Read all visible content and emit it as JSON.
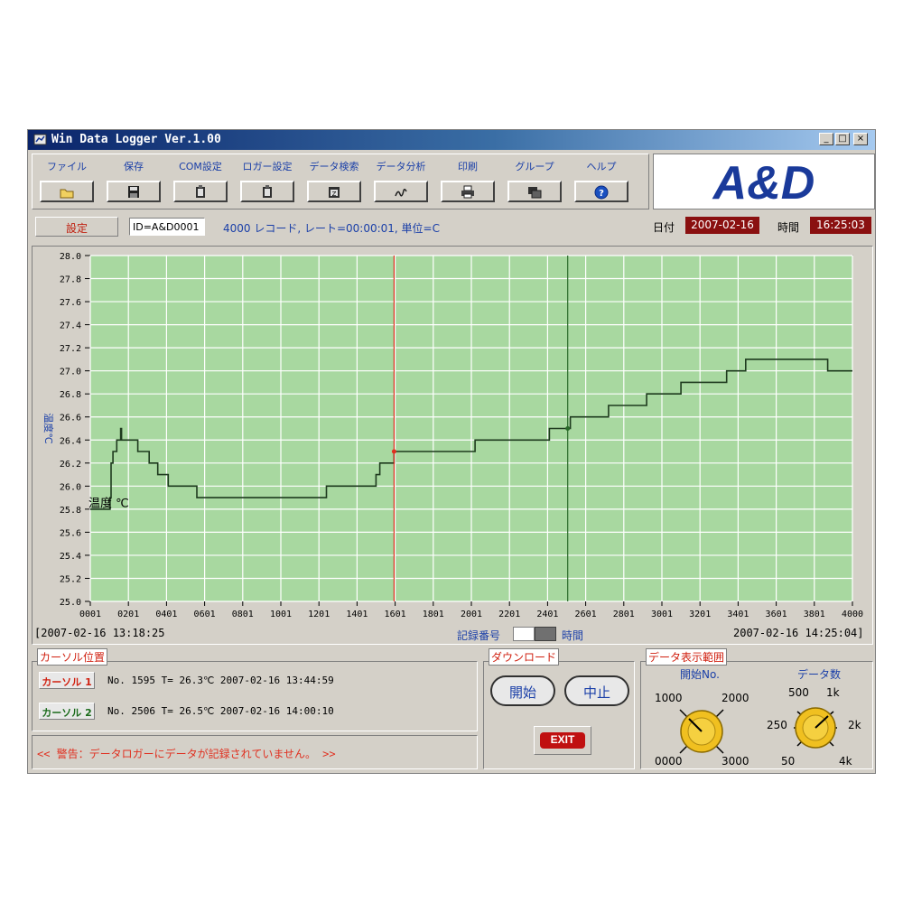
{
  "window": {
    "title": "Win Data Logger Ver.1.00",
    "minimize": "_",
    "maximize": "□",
    "close": "×"
  },
  "toolbar": [
    {
      "label": "ファイル",
      "icon": "open-folder-icon"
    },
    {
      "label": "保存",
      "icon": "floppy-disk-icon"
    },
    {
      "label": "COM設定",
      "icon": "clipboard-icon"
    },
    {
      "label": "ロガー設定",
      "icon": "clipboard-icon"
    },
    {
      "label": "データ検索",
      "icon": "search-window-icon"
    },
    {
      "label": "データ分析",
      "icon": "signature-icon"
    },
    {
      "label": "印刷",
      "icon": "printer-icon"
    },
    {
      "label": "グループ",
      "icon": "group-window-icon"
    },
    {
      "label": "ヘルプ",
      "icon": "help-icon"
    }
  ],
  "logo": {
    "text": "A&D",
    "color": "#1a3a9a"
  },
  "info": {
    "settings_button": "設定",
    "id": "ID=A&D0001",
    "record_info": "4000 レコード, レート=00:00:01, 単位=C",
    "date_label": "日付",
    "date_value": "2007-02-16",
    "time_label": "時間",
    "time_value": "16:25:03"
  },
  "chart_data": {
    "type": "line",
    "ylabel": "温度℃",
    "series": [
      {
        "name": "温度 ℃",
        "color": "#1e3a1e"
      }
    ],
    "ylim": [
      25.0,
      28.0
    ],
    "xlim": [
      1,
      4000
    ],
    "y_ticks": [
      "25.0",
      "25.2",
      "25.4",
      "25.6",
      "25.8",
      "26.0",
      "26.2",
      "26.4",
      "26.6",
      "26.8",
      "27.0",
      "27.2",
      "27.4",
      "27.6",
      "27.8",
      "28.0"
    ],
    "x_ticks": [
      "0001",
      "0201",
      "0401",
      "0601",
      "0801",
      "1001",
      "1201",
      "1401",
      "1601",
      "1801",
      "2001",
      "2201",
      "2401",
      "2601",
      "2801",
      "3001",
      "3201",
      "3401",
      "3601",
      "3801",
      "4000"
    ],
    "grid": true,
    "background": "#a8d8a0",
    "points": [
      [
        1,
        25.8
      ],
      [
        100,
        25.8
      ],
      [
        105,
        25.9
      ],
      [
        110,
        26.2
      ],
      [
        120,
        26.3
      ],
      [
        140,
        26.4
      ],
      [
        155,
        26.4
      ],
      [
        160,
        26.5
      ],
      [
        165,
        26.4
      ],
      [
        240,
        26.4
      ],
      [
        250,
        26.3
      ],
      [
        300,
        26.3
      ],
      [
        310,
        26.2
      ],
      [
        340,
        26.2
      ],
      [
        355,
        26.1
      ],
      [
        400,
        26.1
      ],
      [
        410,
        26.0
      ],
      [
        480,
        26.0
      ],
      [
        490,
        26.0
      ],
      [
        540,
        26.0
      ],
      [
        560,
        25.9
      ],
      [
        1230,
        25.9
      ],
      [
        1240,
        26.0
      ],
      [
        1480,
        26.0
      ],
      [
        1500,
        26.1
      ],
      [
        1520,
        26.2
      ],
      [
        1590,
        26.2
      ],
      [
        1595,
        26.3
      ],
      [
        2000,
        26.3
      ],
      [
        2020,
        26.4
      ],
      [
        2401,
        26.4
      ],
      [
        2410,
        26.5
      ],
      [
        2506,
        26.5
      ],
      [
        2520,
        26.6
      ],
      [
        2700,
        26.6
      ],
      [
        2720,
        26.7
      ],
      [
        2900,
        26.7
      ],
      [
        2920,
        26.8
      ],
      [
        3080,
        26.8
      ],
      [
        3100,
        26.9
      ],
      [
        3180,
        26.9
      ],
      [
        3200,
        26.9
      ],
      [
        3320,
        26.9
      ],
      [
        3340,
        27.0
      ],
      [
        3430,
        27.0
      ],
      [
        3440,
        27.1
      ],
      [
        3860,
        27.1
      ],
      [
        3870,
        27.0
      ],
      [
        4000,
        27.0
      ]
    ],
    "cursor1_x": 1595,
    "cursor2_x": 2506,
    "cursor1_color": "#e03020",
    "cursor2_color": "#2a6a2a",
    "start_time": "[2007-02-16 13:18:25",
    "end_time": "2007-02-16 14:25:04]",
    "x_axis_label": "記録番号",
    "x_axis_alt": "時間"
  },
  "cursor_panel": {
    "title": "カーソル位置",
    "cursor1": {
      "label": "カーソル 1",
      "text": "No. 1595 T= 26.3℃  2007-02-16 13:44:59"
    },
    "cursor2": {
      "label": "カーソル 2",
      "text": "No. 2506 T= 26.5℃  2007-02-16 14:00:10"
    }
  },
  "warning": "<< 警告：データロガーにデータが記録されていません。 >>",
  "download": {
    "title": "ダウンロード",
    "start": "開始",
    "stop": "中止",
    "exit": "EXIT"
  },
  "range": {
    "title": "データ表示範囲",
    "start_no_label": "開始No.",
    "count_label": "データ数",
    "knob1_labels": [
      "1000",
      "2000",
      "0000",
      "3000"
    ],
    "knob2_labels": [
      "500",
      "1k",
      "250",
      "2k",
      "50",
      "4k"
    ],
    "knob_color": "#f0c020"
  }
}
